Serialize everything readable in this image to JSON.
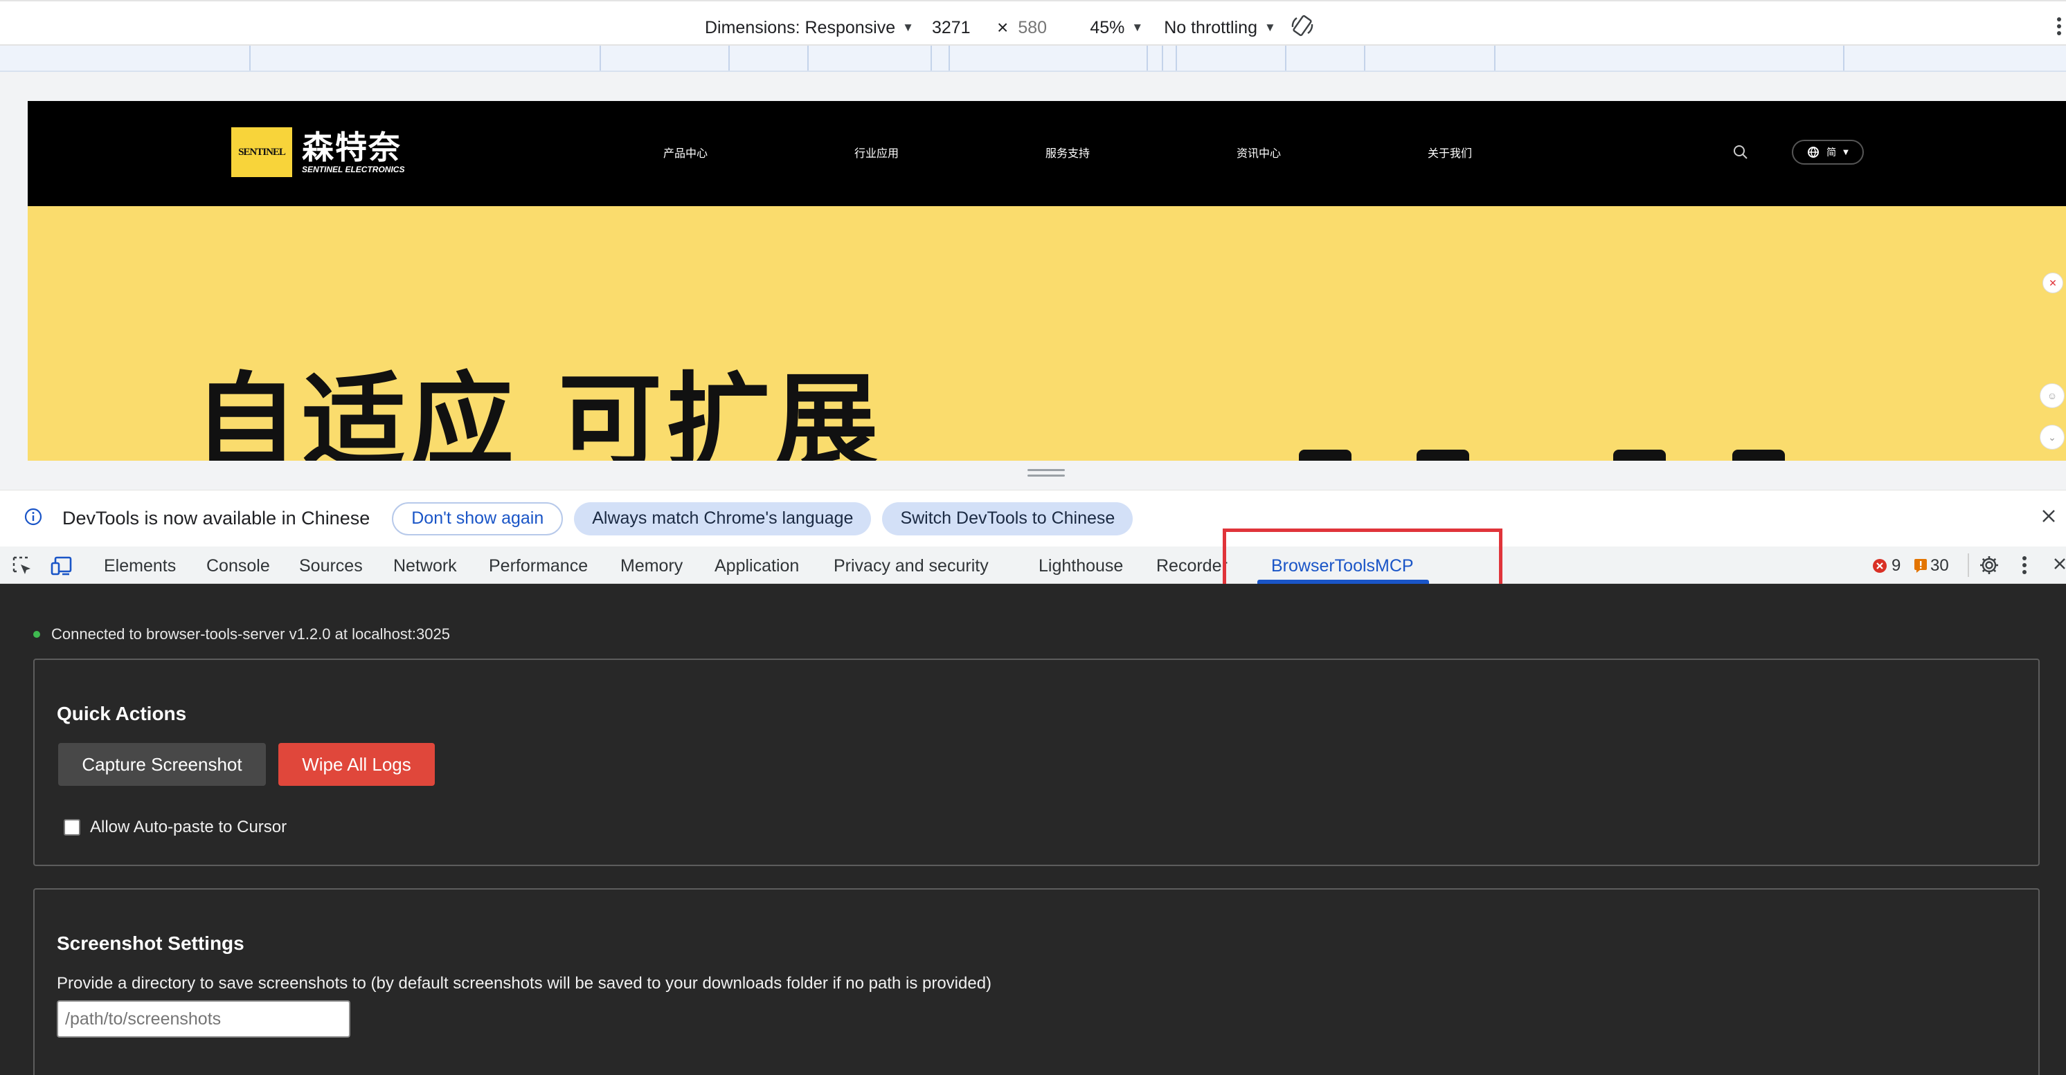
{
  "device_toolbar": {
    "dimensions_label": "Dimensions: Responsive",
    "width_value": "3271",
    "times_symbol": "×",
    "height_placeholder": "580",
    "zoom": "45%",
    "throttling": "No throttling"
  },
  "site": {
    "logo_mark_text": "SENTINEL",
    "logo_cn": "森特奈",
    "logo_en": "SENTINEL ELECTRONICS",
    "nav": [
      "产品中心",
      "行业应用",
      "服务支持",
      "资讯中心",
      "关于我们"
    ],
    "lang": "简",
    "hero_title": "自适应 可扩展"
  },
  "infobar": {
    "message": "DevTools is now available in Chinese",
    "dont_show": "Don't show again",
    "always_match": "Always match Chrome's language",
    "switch": "Switch DevTools to Chinese"
  },
  "tabs": [
    "Elements",
    "Console",
    "Sources",
    "Network",
    "Performance",
    "Memory",
    "Application",
    "Privacy and security",
    "Lighthouse",
    "Recorder",
    "BrowserToolsMCP"
  ],
  "active_tab": "BrowserToolsMCP",
  "counts": {
    "errors": "9",
    "warnings": "30"
  },
  "panel": {
    "connection": "Connected to browser-tools-server v1.2.0 at localhost:3025",
    "quick_actions": {
      "title": "Quick Actions",
      "capture": "Capture Screenshot",
      "wipe": "Wipe All Logs",
      "auto_paste": "Allow Auto-paste to Cursor"
    },
    "screenshot_settings": {
      "title": "Screenshot Settings",
      "description": "Provide a directory to save screenshots to (by default screenshots will be saved to your downloads folder if no path is provided)",
      "path_placeholder": "/path/to/screenshots"
    }
  },
  "colors": {
    "accent": "#1a55c7",
    "wipe_button": "#e0473b",
    "highlight": "#e0343a",
    "panel_bg": "#272727",
    "hero_bg": "#fadc6d"
  }
}
